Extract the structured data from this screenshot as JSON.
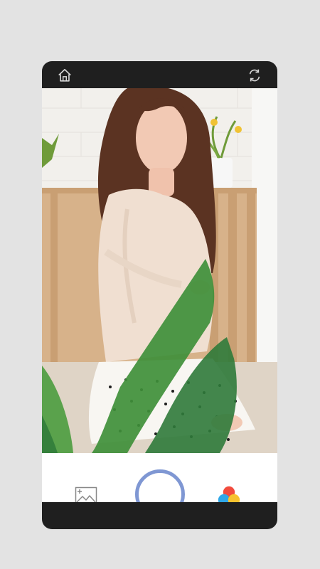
{
  "app": {
    "screen": "camera"
  },
  "topbar": {
    "left_icon": "home-icon",
    "right_icon": "refresh-icon"
  },
  "viewfinder": {
    "content": "photo-preview"
  },
  "controls": {
    "left_icon": "gallery-icon",
    "center_control": "shutter-button",
    "right_icon": "filters-icon",
    "colors": {
      "accent": "#7f97d3",
      "red": "#f24b3d",
      "blue": "#2fa7e8",
      "yellow": "#f7c22f"
    }
  }
}
